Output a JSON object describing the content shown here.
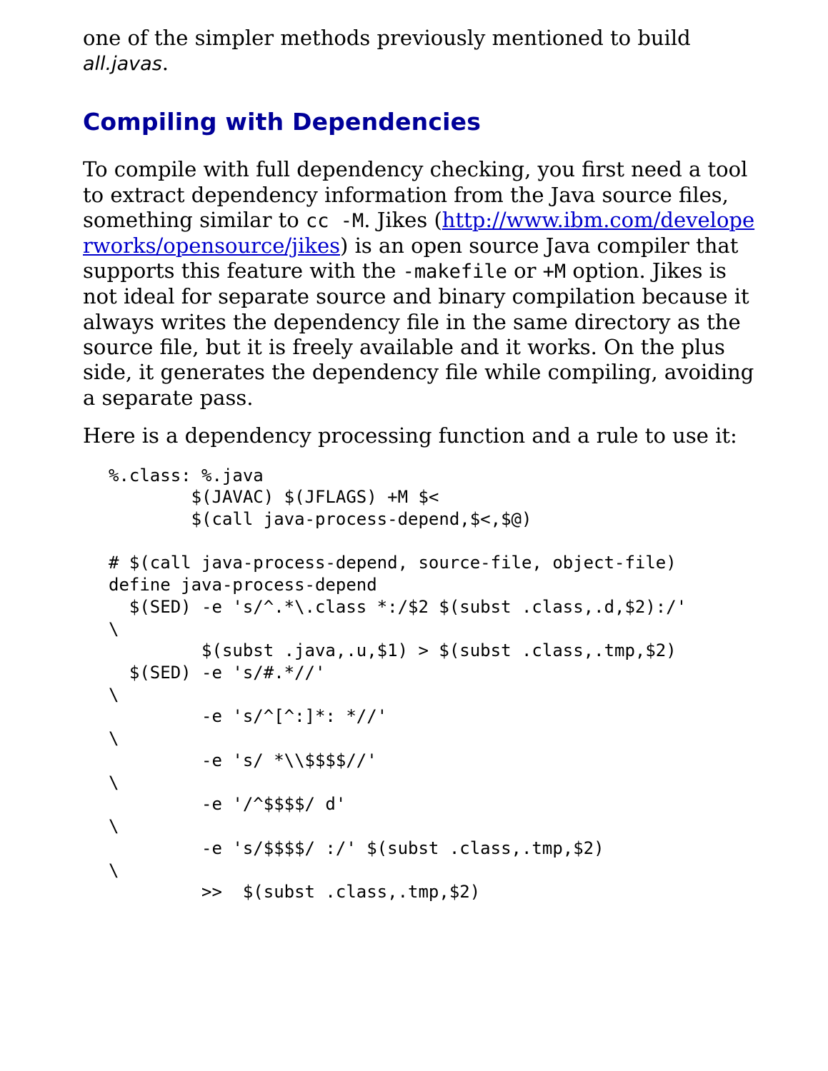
{
  "intro": {
    "before": "one of the simpler methods previously mentioned to build ",
    "italic": "all.javas",
    "after": "."
  },
  "heading": "Compiling with Dependencies",
  "para1": {
    "t1": "To compile with full dependency checking, you first need a tool to extract dependency information from the Java source files, something similar to ",
    "code1": "cc -M",
    "t2": ". Jikes (",
    "link": "http://www.ibm.com/developerworks/opensource/jikes",
    "t3": ") is an open source Java compiler that supports this feature with the ",
    "code2": "-makefile",
    "t4": " or ",
    "code3": "+M",
    "t5": " option. Jikes is not ideal for separate source and binary compilation because it always writes the dependency file in the same directory as the source file, but it is freely available and it works. On the plus side, it generates the dependency file while compiling, avoiding a separate pass."
  },
  "para2": "Here is a dependency processing function and a rule to use it:",
  "code": "%.class: %.java\n        $(JAVAC) $(JFLAGS) +M $<\n        $(call java-process-depend,$<,$@)\n\n# $(call java-process-depend, source-file, object-file)\ndefine java-process-depend\n  $(SED) -e 's/^.*\\.class *:/$2 $(subst .class,.d,$2):/'\n\\\n         $(subst .java,.u,$1) > $(subst .class,.tmp,$2)\n  $(SED) -e 's/#.*//'\n\\\n         -e 's/^[^:]*: *//'\n\\\n         -e 's/ *\\\\$$$$//'\n\\\n         -e '/^$$$$/ d'\n\\\n         -e 's/$$$$/ :/' $(subst .class,.tmp,$2)\n\\\n         >>  $(subst .class,.tmp,$2)"
}
